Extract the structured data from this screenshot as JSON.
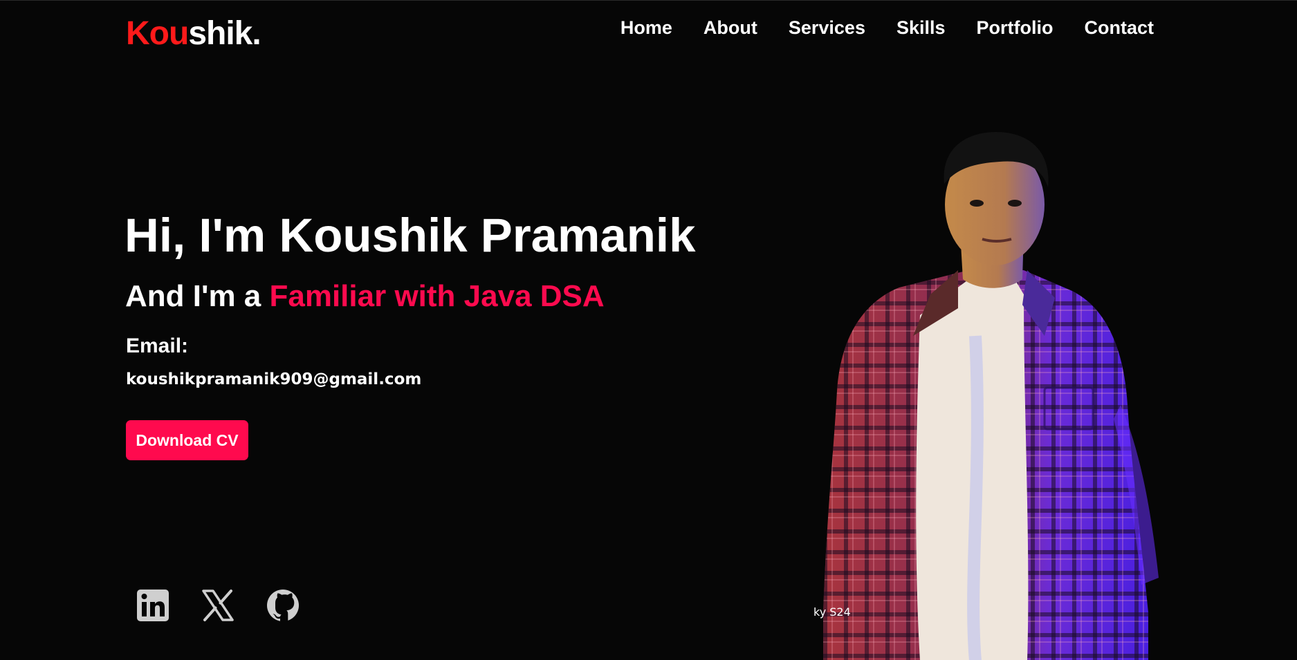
{
  "header": {
    "logo": {
      "accent": "Kou",
      "rest": "shik."
    },
    "nav": [
      {
        "label": "Home"
      },
      {
        "label": "About"
      },
      {
        "label": "Services"
      },
      {
        "label": "Skills"
      },
      {
        "label": "Portfolio"
      },
      {
        "label": "Contact"
      }
    ]
  },
  "hero": {
    "title": "Hi, I'm Koushik Pramanik",
    "subtitle_prefix": "And I'm a ",
    "subtitle_role": "Familiar with Java DSA",
    "email_label": "Email:",
    "email": "koushikpramanik909@gmail.com",
    "cv_button": "Download CV"
  },
  "socials": [
    {
      "icon": "linkedin-icon"
    },
    {
      "icon": "x-twitter-icon"
    },
    {
      "icon": "github-icon"
    }
  ],
  "portrait": {
    "watermark": "ky S24"
  },
  "colors": {
    "background": "#060606",
    "accent": "#ff0a4e",
    "logo_accent": "#ff1a1a",
    "text": "#ffffff",
    "icon": "#cfcfcf"
  }
}
